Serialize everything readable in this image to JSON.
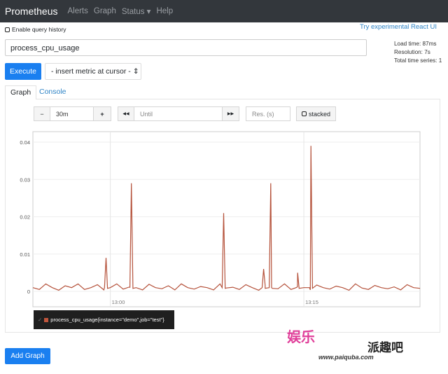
{
  "navbar": {
    "brand": "Prometheus",
    "items": [
      "Alerts",
      "Graph",
      "Status",
      "Help"
    ],
    "status_caret": "▾"
  },
  "query_history_label": "Enable query history",
  "react_link": "Try experimental React UI",
  "query": {
    "value": "process_cpu_usage"
  },
  "stats": {
    "load_time": "Load time: 87ms",
    "resolution": "Resolution: 7s",
    "total_series": "Total time series: 1"
  },
  "execute_label": "Execute",
  "metric_select": "- insert metric at cursor -",
  "tabs": [
    {
      "label": "Graph",
      "active": true
    },
    {
      "label": "Console",
      "active": false
    }
  ],
  "controls": {
    "minus": "−",
    "range": "30m",
    "plus": "+",
    "back": "◀◀",
    "until_placeholder": "Until",
    "forward": "▶▶",
    "res_placeholder": "Res. (s)",
    "stacked_label": "stacked"
  },
  "legend": {
    "check": "✓",
    "series": "process_cpu_usage{instance=\"demo\",job=\"test\"}"
  },
  "add_graph_label": "Add Graph",
  "watermark": {
    "logo": "娱乐",
    "brand": "派趣吧",
    "url": "www.paiquba.com"
  },
  "chart_data": {
    "type": "line",
    "color": "#b5523b",
    "x_range": [
      "12:54",
      "13:24"
    ],
    "x_ticks": [
      "13:00",
      "13:15"
    ],
    "ylim": [
      0,
      0.042
    ],
    "y_ticks": [
      "0",
      "0.01",
      "0.02",
      "0.03",
      "0.04"
    ],
    "grid": true,
    "sample_interval_s": 30,
    "baseline_values": [
      0.001,
      0.0005,
      0.002,
      0.001,
      0.0003,
      0.0015,
      0.001,
      0.002,
      0.0005,
      0.001,
      0.0018,
      0.0004,
      0.001,
      0.002,
      0.0006,
      0.0012,
      0.001,
      0.0004,
      0.0019,
      0.001,
      0.0007,
      0.0015,
      0.0004,
      0.002,
      0.001,
      0.0006,
      0.0013,
      0.001,
      0.0004,
      0.002,
      0.0009,
      0.0011,
      0.0005,
      0.0018,
      0.001,
      0.0003,
      0.0016,
      0.001,
      0.0007,
      0.002,
      0.0005,
      0.0012,
      0.001,
      0.0004,
      0.0017,
      0.001,
      0.0006,
      0.0014,
      0.001,
      0.0003,
      0.002,
      0.0009,
      0.0005,
      0.0016,
      0.001,
      0.0007,
      0.0012,
      0.0004,
      0.0018,
      0.001,
      0.0008
    ],
    "spikes": [
      [
        "12:59:40",
        0.009
      ],
      [
        "13:01:38",
        0.029
      ],
      [
        "13:08:47",
        0.021
      ],
      [
        "13:11:53",
        0.006
      ],
      [
        "13:12:26",
        0.029
      ],
      [
        "13:14:31",
        0.005
      ],
      [
        "13:15:33",
        0.039
      ]
    ]
  }
}
